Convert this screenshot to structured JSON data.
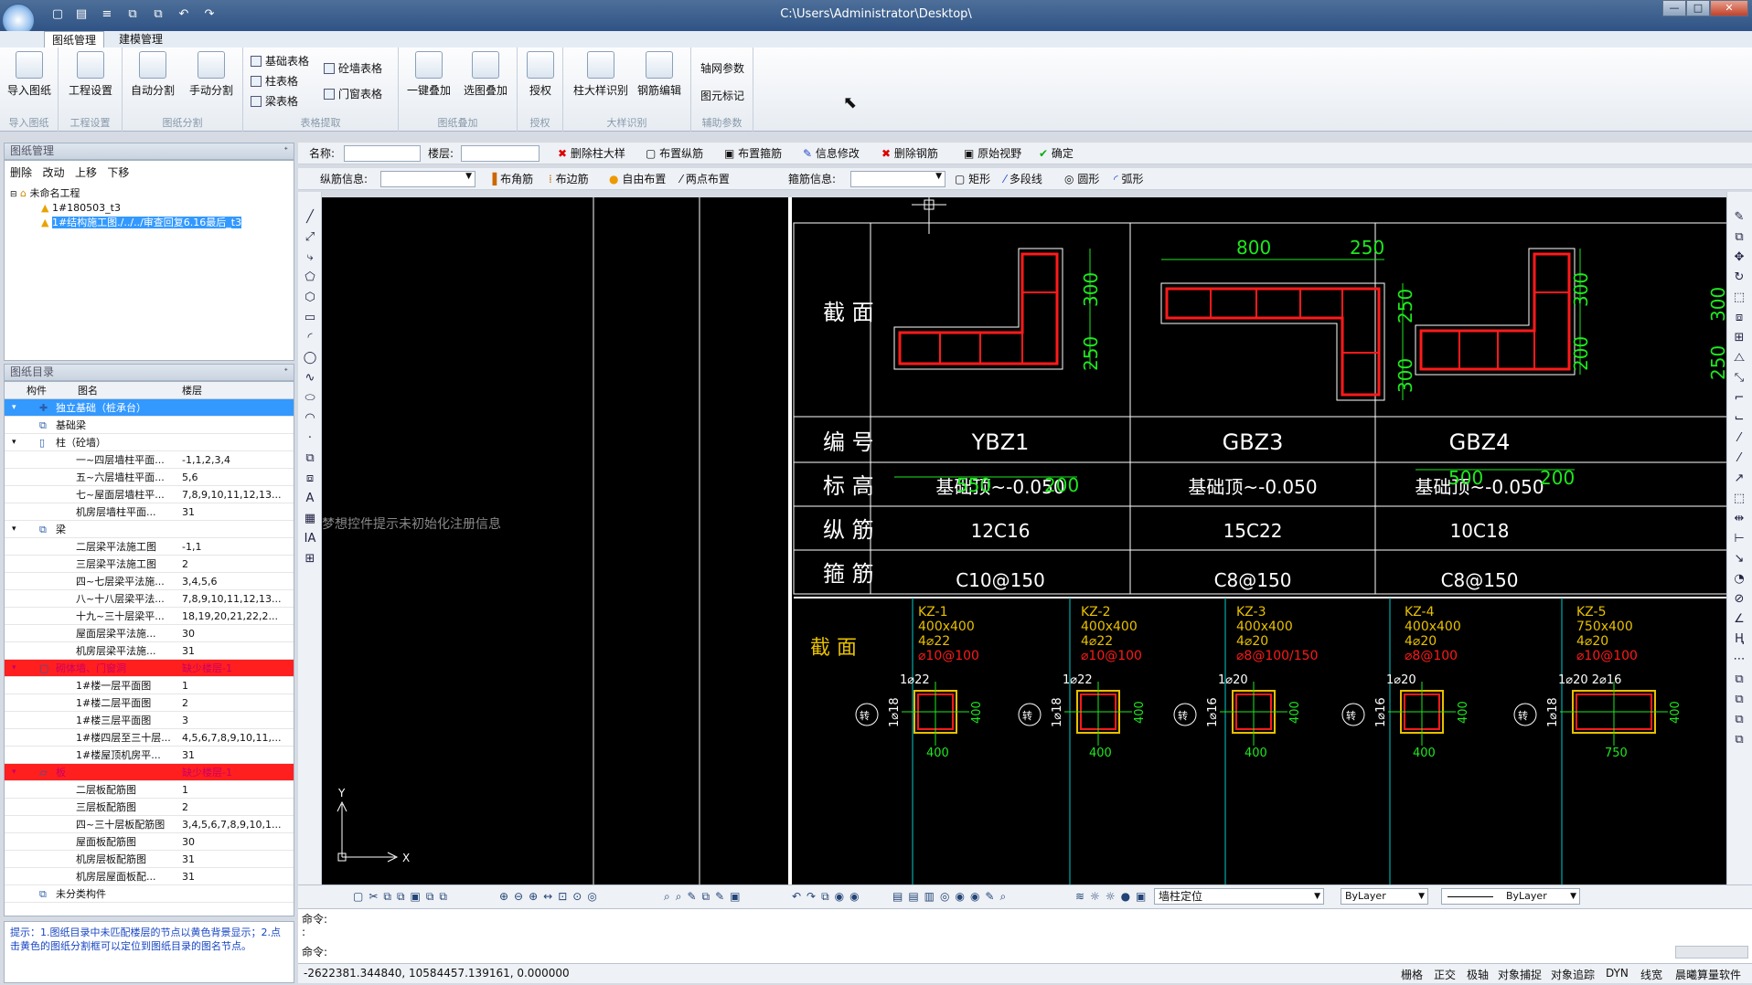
{
  "window": {
    "title": "C:\\Users\\Administrator\\Desktop\\",
    "min": "—",
    "max": "□",
    "close": "✕"
  },
  "ribbon_tabs": [
    "图纸管理",
    "建模管理"
  ],
  "ribbon": {
    "groups": [
      {
        "label": "导入图纸",
        "big": [
          "导入图纸"
        ]
      },
      {
        "label": "工程设置",
        "big": [
          "工程设置"
        ]
      },
      {
        "label": "图纸分割",
        "big": [
          "自动分割",
          "手动分割"
        ]
      },
      {
        "label": "表格提取",
        "small": [
          "基础表格",
          "柱表格",
          "梁表格",
          "砼墙表格",
          "门窗表格"
        ]
      },
      {
        "label": "图纸叠加",
        "big": [
          "一键叠加",
          "选图叠加"
        ]
      },
      {
        "label": "授权",
        "big": [
          "授权"
        ]
      },
      {
        "label": "大样识别",
        "big": [
          "柱大样识别",
          "钢筋编辑"
        ]
      },
      {
        "label": "辅助参数",
        "small": [
          "轴网参数",
          "图元标记"
        ]
      }
    ]
  },
  "drawing_mgmt": {
    "title": "图纸管理",
    "pin": "ᐩ",
    "actions": [
      "删除",
      "改动",
      "上移",
      "下移"
    ],
    "tree": [
      "未命名工程",
      "1#180503_t3",
      "1#结构施工图./../../审查回复6.16最后_t3"
    ]
  },
  "catalog": {
    "title": "图纸目录",
    "pin": "ᐩ",
    "headers": [
      "构件",
      "图名",
      "楼层"
    ],
    "rows": [
      {
        "name": "独立基础（桩承台）",
        "floor": "",
        "level": 0,
        "style": "blue"
      },
      {
        "name": "基础梁",
        "floor": "",
        "level": 0
      },
      {
        "name": "柱（砼墙）",
        "floor": "",
        "level": 0
      },
      {
        "name": "一~四层墙柱平面...",
        "floor": "-1,1,2,3,4",
        "level": 2
      },
      {
        "name": "五~六层墙柱平面...",
        "floor": "5,6",
        "level": 2
      },
      {
        "name": "七~屋面层墙柱平...",
        "floor": "7,8,9,10,11,12,13...",
        "level": 2
      },
      {
        "name": "机房层墙柱平面...",
        "floor": "31",
        "level": 2
      },
      {
        "name": "梁",
        "floor": "",
        "level": 0
      },
      {
        "name": "二层梁平法施工图",
        "floor": "-1,1",
        "level": 2
      },
      {
        "name": "三层梁平法施工图",
        "floor": "2",
        "level": 2
      },
      {
        "name": "四~七层梁平法施...",
        "floor": "3,4,5,6",
        "level": 2
      },
      {
        "name": "八~十八层梁平法...",
        "floor": "7,8,9,10,11,12,13...",
        "level": 2
      },
      {
        "name": "十九~三十层梁平...",
        "floor": "18,19,20,21,22,2...",
        "level": 2
      },
      {
        "name": "屋面层梁平法施...",
        "floor": "30",
        "level": 2
      },
      {
        "name": "机房层梁平法施...",
        "floor": "31",
        "level": 2
      },
      {
        "name": "砌体墙、门窗洞",
        "floor": "缺少楼层-1",
        "level": 0,
        "style": "red"
      },
      {
        "name": "1#楼一层平面图",
        "floor": "1",
        "level": 2
      },
      {
        "name": "1#楼二层平面图",
        "floor": "2",
        "level": 2
      },
      {
        "name": "1#楼三层平面图",
        "floor": "3",
        "level": 2
      },
      {
        "name": "1#楼四层至三十层...",
        "floor": "4,5,6,7,8,9,10,11,...",
        "level": 2
      },
      {
        "name": "1#楼屋顶机房平...",
        "floor": "31",
        "level": 2
      },
      {
        "name": "板",
        "floor": "缺少楼层-1",
        "level": 0,
        "style": "red"
      },
      {
        "name": "二层板配筋图",
        "floor": "1",
        "level": 2
      },
      {
        "name": "三层板配筋图",
        "floor": "2",
        "level": 2
      },
      {
        "name": "四~三十层板配筋图",
        "floor": "3,4,5,6,7,8,9,10,1...",
        "level": 2
      },
      {
        "name": "屋面板配筋图",
        "floor": "30",
        "level": 2
      },
      {
        "name": "机房层板配筋图",
        "floor": "31",
        "level": 2
      },
      {
        "name": "机房层屋面板配...",
        "floor": "31",
        "level": 2
      },
      {
        "name": "未分类构件",
        "floor": "",
        "level": 0
      }
    ]
  },
  "hint": "提示：1.图纸目录中未匹配楼层的节点以黄色背景显示；2.点击黄色的图纸分割框可以定位到图纸目录的图名节点。",
  "toolbar1": {
    "name_label": "名称:",
    "floor_label": "楼层:",
    "buttons": [
      "删除柱大样",
      "布置纵筋",
      "布置箍筋",
      "信息修改",
      "删除钢筋",
      "原始视野",
      "确定"
    ]
  },
  "toolbar2": {
    "long_label": "纵筋信息:",
    "long_buttons": [
      "布角筋",
      "布边筋",
      "自由布置",
      "两点布置"
    ],
    "stirrup_label": "箍筋信息:",
    "stirrup_buttons": [
      "矩形",
      "多段线",
      "圆形",
      "弧形"
    ]
  },
  "canvas": {
    "watermark": "梦想控件提示未初始化注册信息",
    "axis_y": "Y",
    "axis_x": "X",
    "row_labels": [
      "截 面",
      "编 号",
      "标 高",
      "纵 筋",
      "箍 筋"
    ],
    "columns": [
      {
        "id": "YBZ1",
        "elev": "基础顶~-0.050",
        "long": "12C16",
        "stir": "C10@150",
        "dims": [
          "550",
          "200",
          "300",
          "250"
        ]
      },
      {
        "id": "GBZ3",
        "elev": "基础顶~-0.050",
        "long": "15C22",
        "stir": "C8@150",
        "dims": [
          "800",
          "250",
          "250",
          "300"
        ]
      },
      {
        "id": "GBZ4",
        "elev": "基础顶~-0.050",
        "long": "10C18",
        "stir": "C8@150",
        "dims": [
          "500",
          "200",
          "300",
          "200"
        ]
      }
    ],
    "partial_dims": [
      "300",
      "250"
    ],
    "lower_label": "截 面",
    "kz": [
      {
        "name": "KZ-1",
        "size": "400x400",
        "bars": "4⌀22",
        "stir": "⌀10@100",
        "side": "1⌀22",
        "v": "1⌀18",
        "w": "400",
        "h": "400"
      },
      {
        "name": "KZ-2",
        "size": "400x400",
        "bars": "4⌀22",
        "stir": "⌀10@100",
        "side": "1⌀22",
        "v": "1⌀18",
        "w": "400",
        "h": "400"
      },
      {
        "name": "KZ-3",
        "size": "400x400",
        "bars": "4⌀20",
        "stir": "⌀8@100/150",
        "side": "1⌀20",
        "v": "1⌀16",
        "w": "400",
        "h": "400"
      },
      {
        "name": "KZ-4",
        "size": "400x400",
        "bars": "4⌀20",
        "stir": "⌀8@100",
        "side": "1⌀20",
        "v": "1⌀16",
        "w": "400",
        "h": "400"
      },
      {
        "name": "KZ-5",
        "size": "750x400",
        "bars": "4⌀20",
        "stir": "⌀10@100",
        "side": "1⌀20 2⌀16",
        "v": "1⌀18",
        "w": "750",
        "h": "400"
      }
    ],
    "kz_tag": "转"
  },
  "bottombar": {
    "layer": "墙柱定位",
    "color": "ByLayer",
    "linetype": "ByLayer"
  },
  "command": {
    "line1": "命令:",
    "line2": ":",
    "line3": "命令:"
  },
  "status": {
    "coords": "-2622381.344840,  10584457.139161,  0.000000",
    "toggles": [
      "栅格",
      "正交",
      "极轴",
      "对象捕捉",
      "对象追踪",
      "DYN",
      "线宽",
      "晨曦算量软件"
    ]
  }
}
